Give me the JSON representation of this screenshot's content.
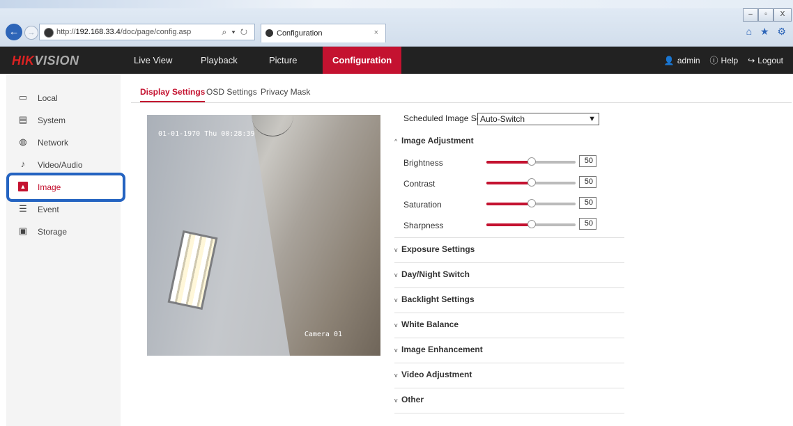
{
  "browser": {
    "url_prefix": "http://",
    "url_host": "192.168.33.4",
    "url_path": "/doc/page/config.asp",
    "address_controls": "⌕ ▾ ↻",
    "tab_title": "Configuration",
    "tab_close": "×",
    "right_icons": "⌂ ★ ⚙"
  },
  "app": {
    "logo_red": "HIK",
    "logo_gray": "VISION",
    "nav": [
      "Live View",
      "Playback",
      "Picture",
      "Configuration"
    ],
    "user": "admin",
    "help": "Help",
    "logout": "Logout"
  },
  "sidebar": {
    "items": [
      {
        "label": "Local",
        "icon": "monitor-icon"
      },
      {
        "label": "System",
        "icon": "system-icon"
      },
      {
        "label": "Network",
        "icon": "globe-icon"
      },
      {
        "label": "Video/Audio",
        "icon": "video-audio-icon"
      },
      {
        "label": "Image",
        "icon": "image-icon"
      },
      {
        "label": "Event",
        "icon": "event-icon"
      },
      {
        "label": "Storage",
        "icon": "storage-icon"
      }
    ],
    "selected": "Image"
  },
  "subtabs": [
    "Display Settings",
    "OSD Settings",
    "Privacy Mask"
  ],
  "video": {
    "osd_time": "01-01-1970 Thu 00:28:39",
    "osd_camera": "Camera 01"
  },
  "settings": {
    "scheduled_label": "Scheduled Image Settings",
    "scheduled_value": "Auto-Switch",
    "image_adjustment": "Image Adjustment",
    "sliders": [
      {
        "label": "Brightness",
        "value": "50"
      },
      {
        "label": "Contrast",
        "value": "50"
      },
      {
        "label": "Saturation",
        "value": "50"
      },
      {
        "label": "Sharpness",
        "value": "50"
      }
    ],
    "sections": [
      "Exposure Settings",
      "Day/Night Switch",
      "Backlight Settings",
      "White Balance",
      "Image Enhancement",
      "Video Adjustment",
      "Other"
    ]
  },
  "colors": {
    "accent": "#c41230",
    "header": "#222222",
    "highlight": "#2463c1"
  }
}
